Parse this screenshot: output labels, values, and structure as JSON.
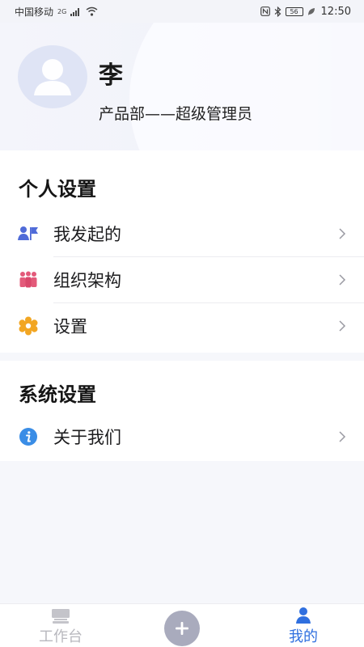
{
  "status_bar": {
    "carrier": "中国移动",
    "network": "2G",
    "battery": "56",
    "time": "12:50"
  },
  "profile": {
    "name": "李",
    "role": "产品部——超级管理员"
  },
  "personal_settings": {
    "title": "个人设置",
    "items": [
      {
        "label": "我发起的",
        "icon": "flag-user-icon"
      },
      {
        "label": "组织架构",
        "icon": "group-icon"
      },
      {
        "label": "设置",
        "icon": "gear-flower-icon"
      }
    ]
  },
  "system_settings": {
    "title": "系统设置",
    "items": [
      {
        "label": "关于我们",
        "icon": "info-icon"
      }
    ]
  },
  "bottom_nav": {
    "workbench_label": "工作台",
    "mine_label": "我的",
    "active": "mine"
  },
  "colors": {
    "accent": "#2f6fdf",
    "flag": "#4f6bd8",
    "group": "#e35a7a",
    "gear": "#f2a623",
    "info": "#3a8de6",
    "nav_inactive": "#b8b8be",
    "fab": "#a9abbd"
  }
}
